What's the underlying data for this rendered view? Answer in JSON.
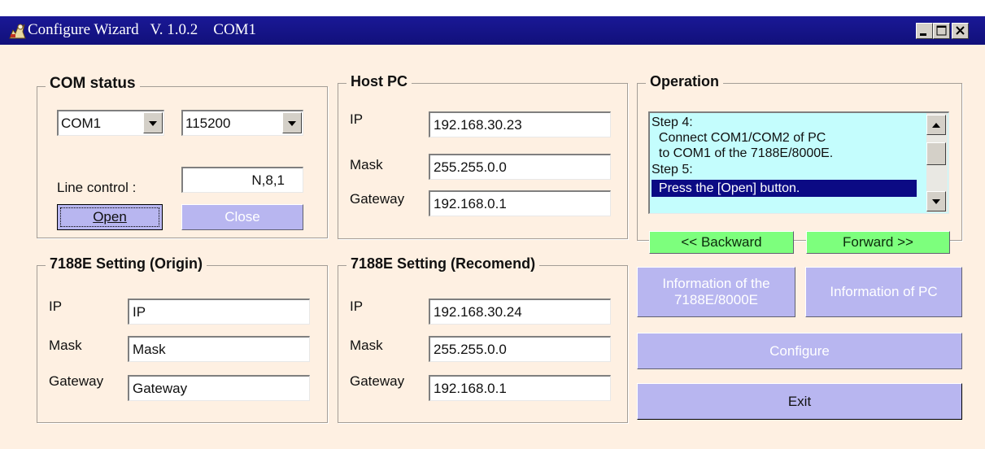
{
  "window": {
    "title": "Configure Wizard   V. 1.0.2    COM1",
    "controls": {
      "minimize": "minimize-icon",
      "maximize": "maximize-icon",
      "close": "close-icon"
    }
  },
  "com_status": {
    "legend": "COM status",
    "port_value": "COM1",
    "baud_value": "115200",
    "line_control_label": "Line control :",
    "line_control_value": "N,8,1",
    "open_label": "Open",
    "close_label": "Close"
  },
  "host_pc": {
    "legend": "Host PC",
    "ip_label": "IP",
    "ip_value": "192.168.30.23",
    "mask_label": "Mask",
    "mask_value": "255.255.0.0",
    "gateway_label": "Gateway",
    "gateway_value": "192.168.0.1"
  },
  "operation": {
    "legend": "Operation",
    "steps": [
      "Step 4:",
      "  Connect COM1/COM2 of PC",
      "  to COM1 of the 7188E/8000E.",
      "Step 5:",
      "  Press the [Open] button."
    ],
    "selected_index": 4,
    "backward_label": "<< Backward",
    "forward_label": "Forward >>"
  },
  "origin": {
    "legend": "7188E Setting (Origin)",
    "ip_label": "IP",
    "ip_value": "IP",
    "mask_label": "Mask",
    "mask_value": "Mask",
    "gateway_label": "Gateway",
    "gateway_value": "Gateway"
  },
  "recommend": {
    "legend": "7188E Setting (Recomend)",
    "ip_label": "IP",
    "ip_value": "192.168.30.24",
    "mask_label": "Mask",
    "mask_value": "255.255.0.0",
    "gateway_label": "Gateway",
    "gateway_value": "192.168.0.1"
  },
  "actions": {
    "info_device_line1": "Information of the",
    "info_device_line2": "7188E/8000E",
    "info_pc_label": "Information of  PC",
    "configure_label": "Configure",
    "exit_label": "Exit"
  },
  "colors": {
    "window_bg": "#fef0e2",
    "titlebar": "#11107a",
    "button": "#b8b6f0",
    "nav_button": "#7dff7d",
    "listbox": "#c4fdfd",
    "selection": "#0b0a84"
  }
}
